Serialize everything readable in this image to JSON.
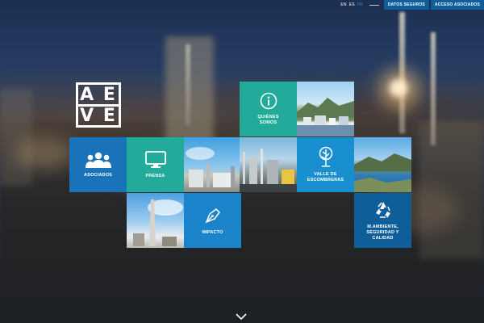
{
  "topbar": {
    "languages": [
      "EN",
      "ES",
      "FR"
    ],
    "active_language": "FR",
    "links": [
      "DATOS SEGUROS",
      "ACCESO ASOCIADOS"
    ]
  },
  "logo": {
    "row1": "A E",
    "row2": "V E"
  },
  "tiles": {
    "quienes": {
      "label_1": "QUIÉNES",
      "label_2": "SOMOS",
      "icon": "info-icon"
    },
    "asociados": {
      "label": "ASOCIADOS",
      "icon": "people-icon"
    },
    "prensa": {
      "label": "PRENSA",
      "icon": "monitor-icon"
    },
    "valle": {
      "label_1": "VALLE DE",
      "label_2": "ESCOMBRERAS",
      "icon": "tree-icon"
    },
    "impacto": {
      "label": "IMPACTO",
      "icon": "pen-nib-icon"
    },
    "medio": {
      "label_1": "M.AMBIENTE,",
      "label_2": "SEGURIDAD Y",
      "label_3": "CALIDAD",
      "icon": "recycle-icon"
    }
  },
  "colors": {
    "tile_blue": "#1a73b8",
    "tile_teal": "#22ab9a",
    "tile_navy": "#0e5f99",
    "top_link": "#0f5e9c"
  },
  "scroll_icon": "chevron-down-icon"
}
